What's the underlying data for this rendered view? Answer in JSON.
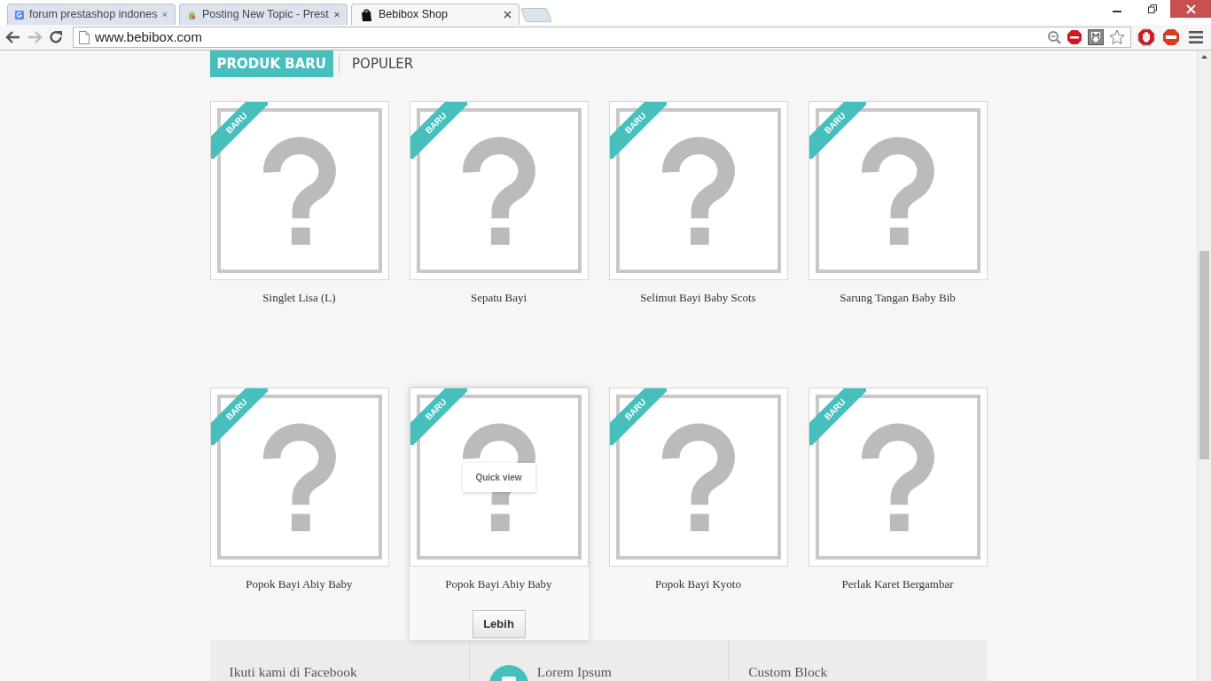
{
  "browser": {
    "tabs": [
      {
        "title": "forum prestashop indones",
        "kind": "google",
        "selected": false
      },
      {
        "title": "Posting New Topic - Prest",
        "kind": "prestashop",
        "selected": false
      },
      {
        "title": "Bebibox Shop",
        "kind": "shop",
        "selected": true
      }
    ],
    "url": "www.bebibox.com"
  },
  "page": {
    "tabs": [
      {
        "label": "PRODUK BARU",
        "selected": true
      },
      {
        "label": "POPULER",
        "selected": false
      }
    ],
    "products": [
      {
        "name": "Singlet Lisa (L)",
        "badge": "BARU",
        "hovered": false
      },
      {
        "name": "Sepatu Bayi",
        "badge": "BARU",
        "hovered": false
      },
      {
        "name": "Selimut Bayi Baby Scots",
        "badge": "BARU",
        "hovered": false
      },
      {
        "name": "Sarung Tangan Baby Bib",
        "badge": "BARU",
        "hovered": false
      },
      {
        "name": "Popok Bayi Abiy Baby",
        "badge": "BARU",
        "hovered": false
      },
      {
        "name": "Popok Bayi Abiy Baby",
        "badge": "BARU",
        "hovered": true,
        "quick_view": "Quick view",
        "more_button": "Lebih"
      },
      {
        "name": "Popok Bayi Kyoto",
        "badge": "BARU",
        "hovered": false
      },
      {
        "name": "Perlak Karet Bergambar",
        "badge": "BARU",
        "hovered": false
      }
    ],
    "footer_blocks": [
      {
        "title": "Ikuti kami di Facebook",
        "kind": "text"
      },
      {
        "title": "Lorem Ipsum",
        "kind": "icon"
      },
      {
        "title": "Custom Block",
        "kind": "text"
      }
    ]
  }
}
